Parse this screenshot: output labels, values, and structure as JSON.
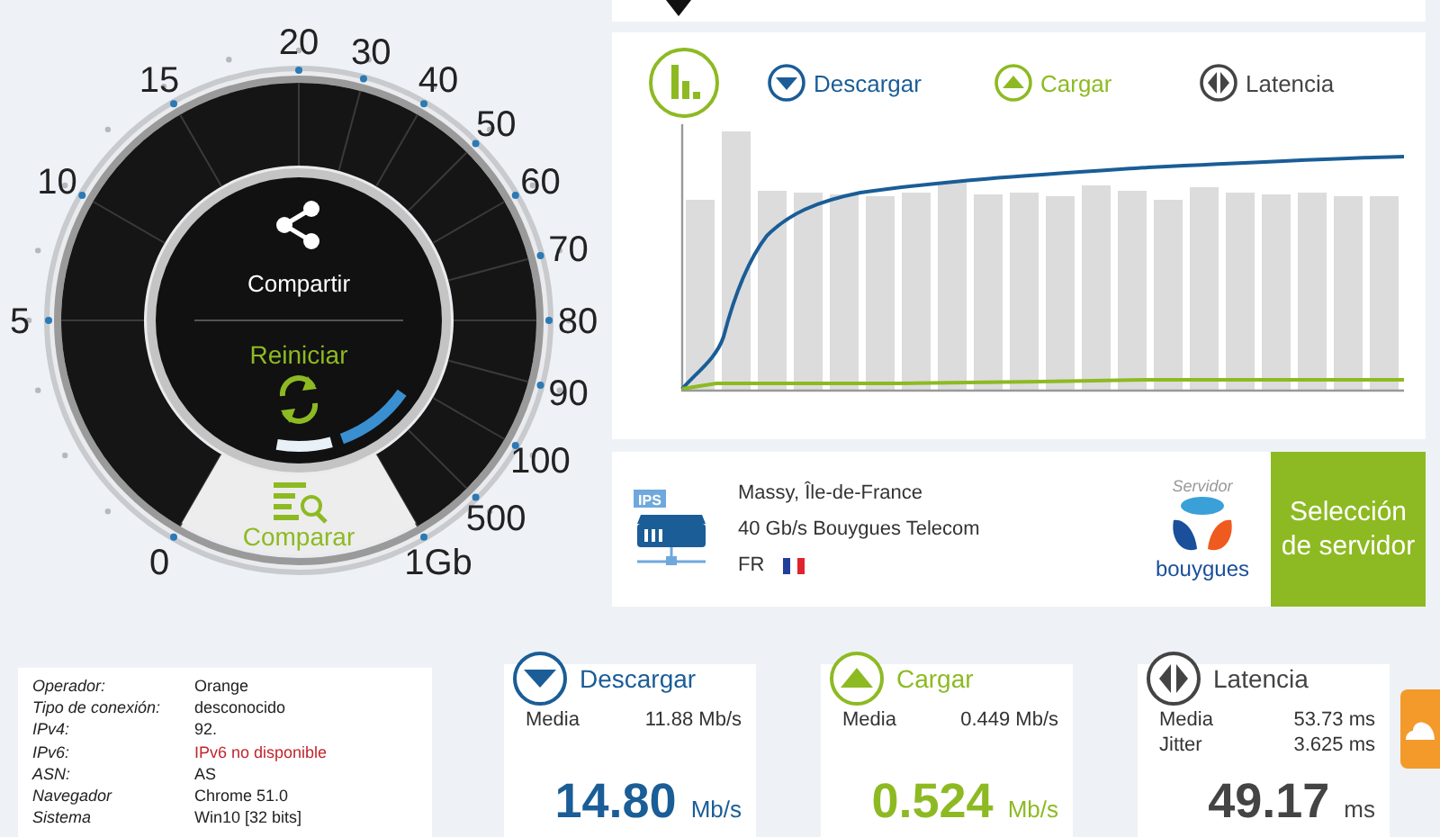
{
  "gauge": {
    "scale": [
      "0",
      "5",
      "10",
      "15",
      "20",
      "30",
      "40",
      "50",
      "60",
      "70",
      "80",
      "90",
      "100",
      "500",
      "1Gb"
    ],
    "share_label": "Compartir",
    "restart_label": "Reiniciar",
    "compare_label": "Comparar"
  },
  "chart_panel": {
    "legend": [
      {
        "kind": "download",
        "label": "Descargar"
      },
      {
        "kind": "upload",
        "label": "Cargar"
      },
      {
        "kind": "latency",
        "label": "Latencia"
      }
    ]
  },
  "server": {
    "icon_badge": "IPS",
    "location": "Massy, Île-de-France",
    "provider": "40 Gb/s Bouygues Telecom",
    "country": "FR",
    "caption": "Servidor",
    "logo_text": "bouygues",
    "select_button": "Selección de servidor"
  },
  "connection_info": [
    {
      "label": "Operador:",
      "value": "Orange",
      "alert": false
    },
    {
      "label": "Tipo de conexión:",
      "value": "desconocido",
      "alert": false
    },
    {
      "label": "IPv4:",
      "value": "92.",
      "alert": false
    },
    {
      "label": "IPv6:",
      "value": "IPv6 no disponible",
      "alert": true
    },
    {
      "label": "ASN:",
      "value": "AS",
      "alert": false
    },
    {
      "label": "Navegador",
      "value": "Chrome 51.0",
      "alert": false
    },
    {
      "label": "Sistema",
      "value": "Win10 [32 bits]",
      "alert": false
    }
  ],
  "results": [
    {
      "kind": "download",
      "title": "Descargar",
      "rows": [
        {
          "label": "Media",
          "value": "11.88 Mb/s"
        }
      ],
      "value": "14.80",
      "unit": "Mb/s"
    },
    {
      "kind": "upload",
      "title": "Cargar",
      "rows": [
        {
          "label": "Media",
          "value": "0.449 Mb/s"
        }
      ],
      "value": "0.524",
      "unit": "Mb/s"
    },
    {
      "kind": "latency",
      "title": "Latencia",
      "rows": [
        {
          "label": "Media",
          "value": "53.73 ms"
        },
        {
          "label": "Jitter",
          "value": "3.625 ms"
        }
      ],
      "value": "49.17",
      "unit": "ms"
    }
  ]
}
